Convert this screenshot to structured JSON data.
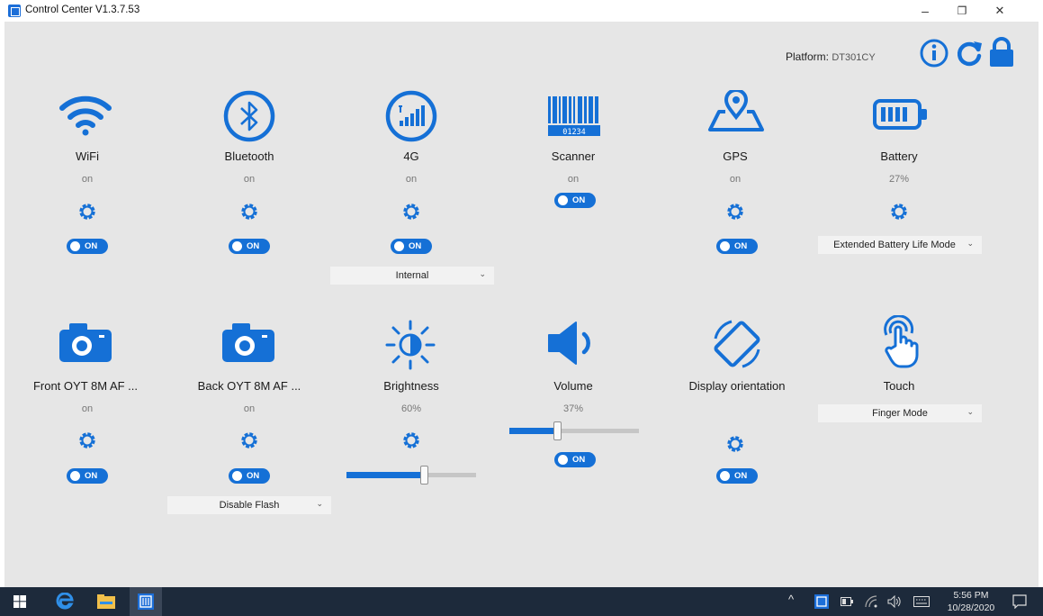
{
  "window": {
    "title": "Control Center V1.3.7.53",
    "minimize": "–",
    "restore": "❐",
    "close": "✕"
  },
  "header": {
    "platform_label": "Platform:",
    "platform_value": "DT301CY"
  },
  "colors": {
    "accent": "#1570d6",
    "background": "#e6e6e6",
    "taskbar": "#1d2a3b"
  },
  "toggle_label": "ON",
  "tiles": {
    "wifi": {
      "label": "WiFi",
      "status": "on",
      "icon": "wifi-icon"
    },
    "bluetooth": {
      "label": "Bluetooth",
      "status": "on",
      "icon": "bluetooth-icon"
    },
    "cell": {
      "label": "4G",
      "status": "on",
      "icon": "cellular-signal-icon",
      "dropdown": "Internal"
    },
    "scanner": {
      "label": "Scanner",
      "status": "on",
      "icon": "barcode-scanner-icon"
    },
    "gps": {
      "label": "GPS",
      "status": "on",
      "icon": "gps-location-icon"
    },
    "battery": {
      "label": "Battery",
      "status": "27%",
      "icon": "battery-icon",
      "dropdown": "Extended Battery Life Mode"
    },
    "front_camera": {
      "label": "Front OYT 8M AF ...",
      "status": "on",
      "icon": "camera-icon"
    },
    "back_camera": {
      "label": "Back OYT 8M AF ...",
      "status": "on",
      "icon": "camera-icon",
      "dropdown": "Disable Flash"
    },
    "brightness": {
      "label": "Brightness",
      "status": "60%",
      "icon": "brightness-icon",
      "level": 0.6
    },
    "volume": {
      "label": "Volume",
      "status": "37%",
      "icon": "speaker-icon",
      "level": 0.37
    },
    "orientation": {
      "label": "Display orientation",
      "icon": "rotate-screen-icon"
    },
    "touch": {
      "label": "Touch",
      "icon": "touch-finger-icon",
      "dropdown": "Finger Mode"
    }
  },
  "taskbar": {
    "time": "5:56 PM",
    "date": "10/28/2020",
    "tray_chevron": "^"
  }
}
